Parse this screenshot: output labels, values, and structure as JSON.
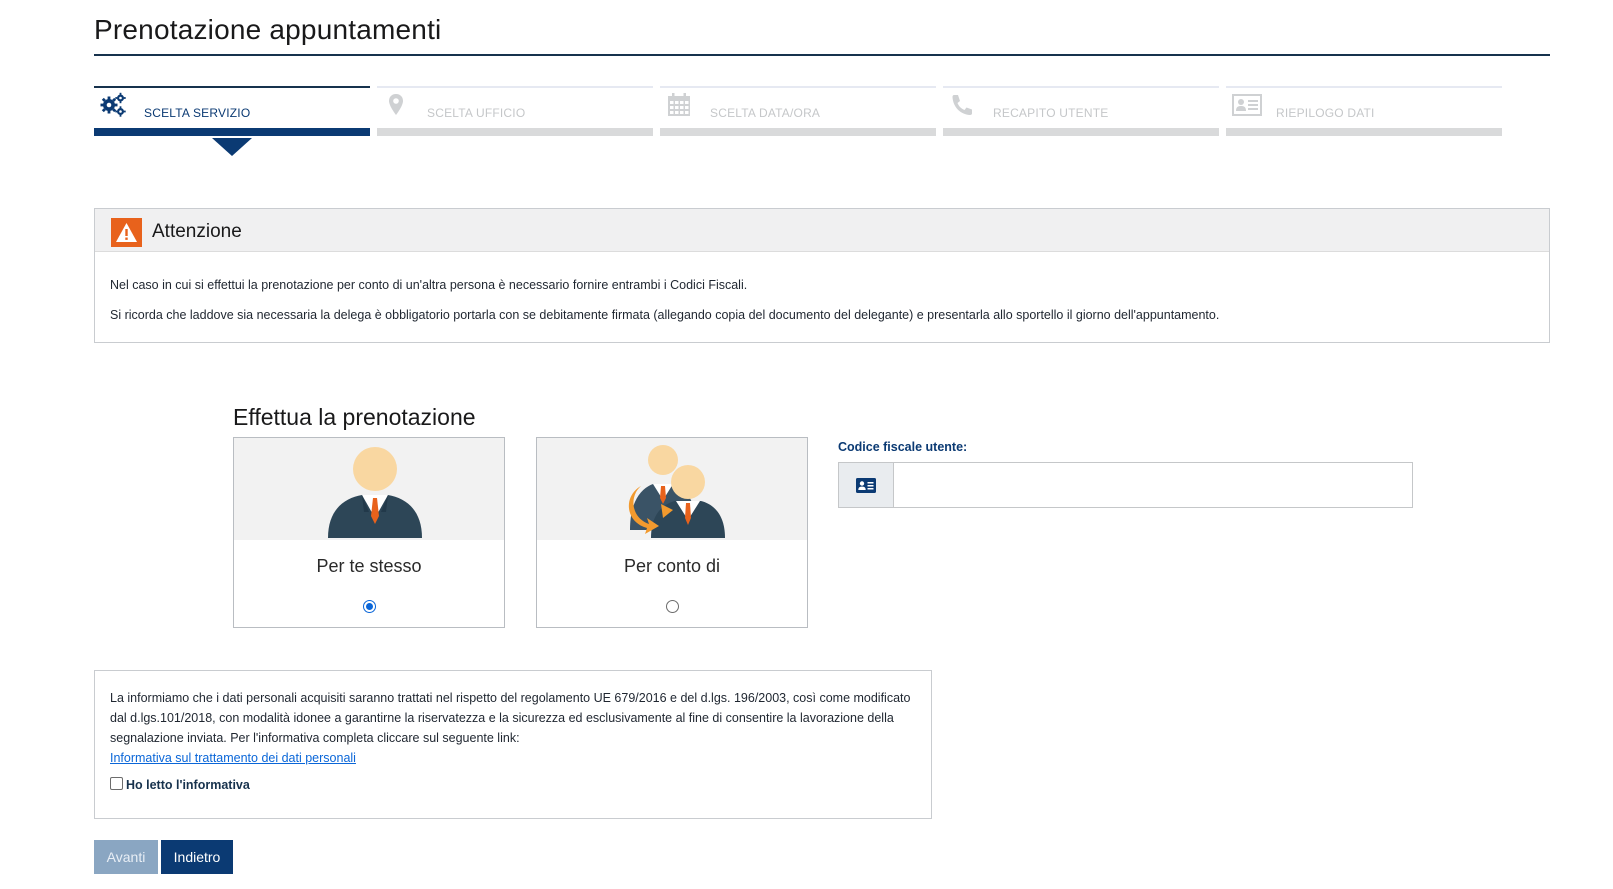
{
  "page": {
    "title": "Prenotazione appuntamenti"
  },
  "stepper": {
    "steps": [
      {
        "label": "SCELTA SERVIZIO",
        "icon": "gears-icon",
        "active": true
      },
      {
        "label": "SCELTA UFFICIO",
        "icon": "map-marker-icon",
        "active": false
      },
      {
        "label": "SCELTA DATA/ORA",
        "icon": "calendar-icon",
        "active": false
      },
      {
        "label": "RECAPITO UTENTE",
        "icon": "phone-icon",
        "active": false
      },
      {
        "label": "RIEPILOGO DATI",
        "icon": "id-card-icon",
        "active": false
      }
    ]
  },
  "alert": {
    "title": "Attenzione",
    "icon": "warning-icon",
    "lines": [
      "Nel caso in cui si effettui la prenotazione per conto di un'altra persona è necessario fornire entrambi i Codici Fiscali.",
      "Si ricorda che laddove sia necessaria la delega è obbligatorio portarla con se debitamente firmata (allegando copia del documento del delegante) e presentarla allo sportello il giorno dell'appuntamento."
    ]
  },
  "booking": {
    "title": "Effettua la prenotazione",
    "options": [
      {
        "label": "Per te stesso",
        "icon": "single-person-icon",
        "selected": true
      },
      {
        "label": "Per conto di",
        "icon": "delegate-persons-icon",
        "selected": false
      }
    ],
    "codice_fiscale": {
      "label": "Codice fiscale utente:",
      "value": "",
      "icon": "id-card-icon"
    }
  },
  "privacy": {
    "text": "La informiamo che i dati personali acquisiti saranno trattati nel rispetto del regolamento UE 679/2016 e del d.lgs. 196/2003, così come modificato dal d.lgs.101/2018, con modalità idonee a garantirne la riservatezza e la sicurezza ed esclusivamente al fine di consentire la lavorazione della segnalazione inviata. Per l'informativa completa cliccare sul seguente link:",
    "link_label": "Informativa sul trattamento dei dati personali",
    "checkbox_label": "Ho letto l'informativa",
    "checked": false
  },
  "buttons": {
    "next_label": "Avanti",
    "back_label": "Indietro"
  },
  "colors": {
    "primary": "#0b3a73",
    "inactive": "#d9dadb",
    "warning": "#e8621c",
    "link": "#0a66d8"
  }
}
